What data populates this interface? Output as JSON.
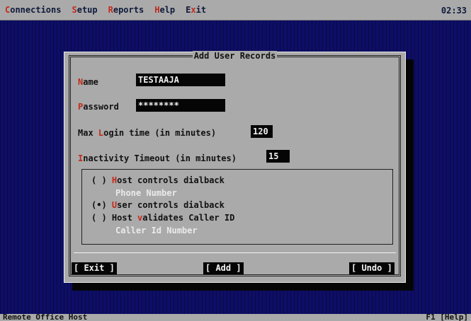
{
  "menubar": {
    "items": [
      {
        "hot": "C",
        "rest": "onnections"
      },
      {
        "hot": "S",
        "rest": "etup"
      },
      {
        "hot": "R",
        "rest": "eports"
      },
      {
        "hot": "H",
        "rest": "elp"
      },
      {
        "pre": "E",
        "hot": "x",
        "rest": "it"
      }
    ],
    "clock": "02:33"
  },
  "dialog": {
    "title": "Add User Records",
    "name": {
      "hot": "N",
      "rest": "ame",
      "value": "TESTAAJA"
    },
    "password": {
      "hot": "P",
      "rest": "assword",
      "value": "********"
    },
    "max_login": {
      "pre": "Max ",
      "hot": "L",
      "rest": "ogin time (in minutes)",
      "value": "120"
    },
    "inactivity": {
      "hot": "I",
      "rest": "nactivity Timeout (in minutes)",
      "value": "15"
    },
    "options": [
      {
        "radio": "( )",
        "pre": "",
        "hot": "H",
        "rest": "ost controls dialback"
      },
      {
        "radio": "(•)",
        "pre": "",
        "hot": "U",
        "rest": "ser controls dialback"
      },
      {
        "radio": "( )",
        "pre": "Host ",
        "hot": "v",
        "rest": "alidates Caller ID"
      }
    ],
    "phone_number_label": "Phone Number",
    "caller_id_label": "Caller Id Number",
    "buttons": {
      "exit": "[ Exit ]",
      "add": "[ Add ]",
      "undo": "[ Undo ]"
    }
  },
  "statusbar": {
    "left": "Remote Office Host",
    "right": "F1 [Help]"
  },
  "colors": {
    "background": "#0e0e68",
    "panel": "#aaaaaa",
    "hotkey": "#c22a1a",
    "field_bg": "#050505",
    "field_text": "#f0f0f0"
  }
}
